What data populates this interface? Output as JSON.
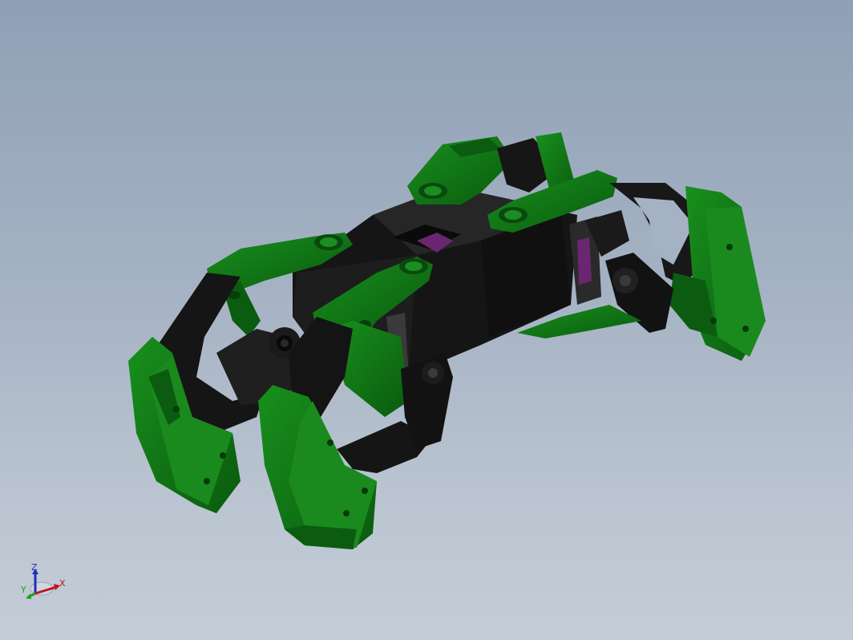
{
  "viewport": {
    "background_top": "#8fa0b6",
    "background_bottom": "#c3ccd7"
  },
  "model": {
    "part_colors": {
      "shell": "#0e6e14",
      "shell_dark": "#064d0a",
      "frame": "#141414",
      "servo_accent": "#8a2a8a"
    }
  },
  "triad": {
    "x_label": "X",
    "y_label": "Y",
    "z_label": "Z",
    "x_color": "#c0161a",
    "y_color": "#1aa11a",
    "z_color": "#1c2fb8"
  }
}
